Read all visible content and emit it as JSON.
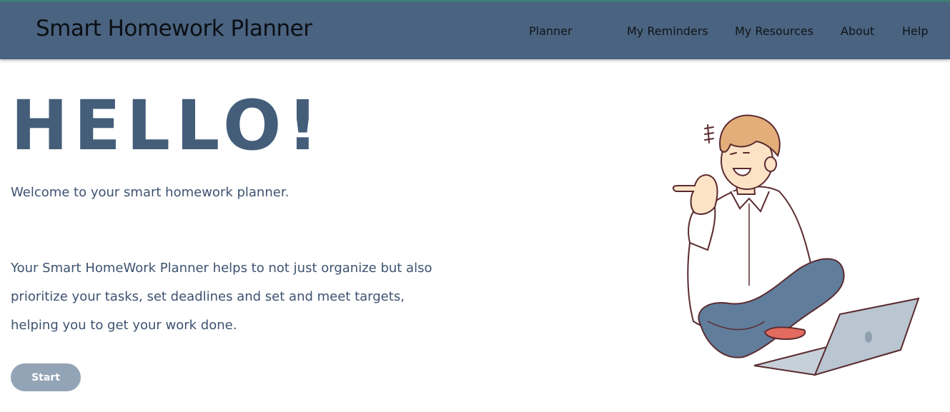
{
  "header": {
    "brand": "Smart Homework Planner",
    "nav": [
      "Planner",
      "My Reminders",
      "My Resources",
      "About",
      "Help"
    ]
  },
  "hero": {
    "heading": "HELLO!",
    "welcome": "Welcome to your smart homework planner.",
    "description_lines": [
      "Your Smart HomeWork Planner helps to not just organize but also",
      "prioritize your tasks, set deadlines and set and meet targets,",
      "helping you to get your work done."
    ],
    "start_label": "Start"
  },
  "colors": {
    "header_bg": "#4a6380",
    "heading": "#445e7a",
    "text": "#3d5270",
    "button_bg": "#93a4b6"
  }
}
